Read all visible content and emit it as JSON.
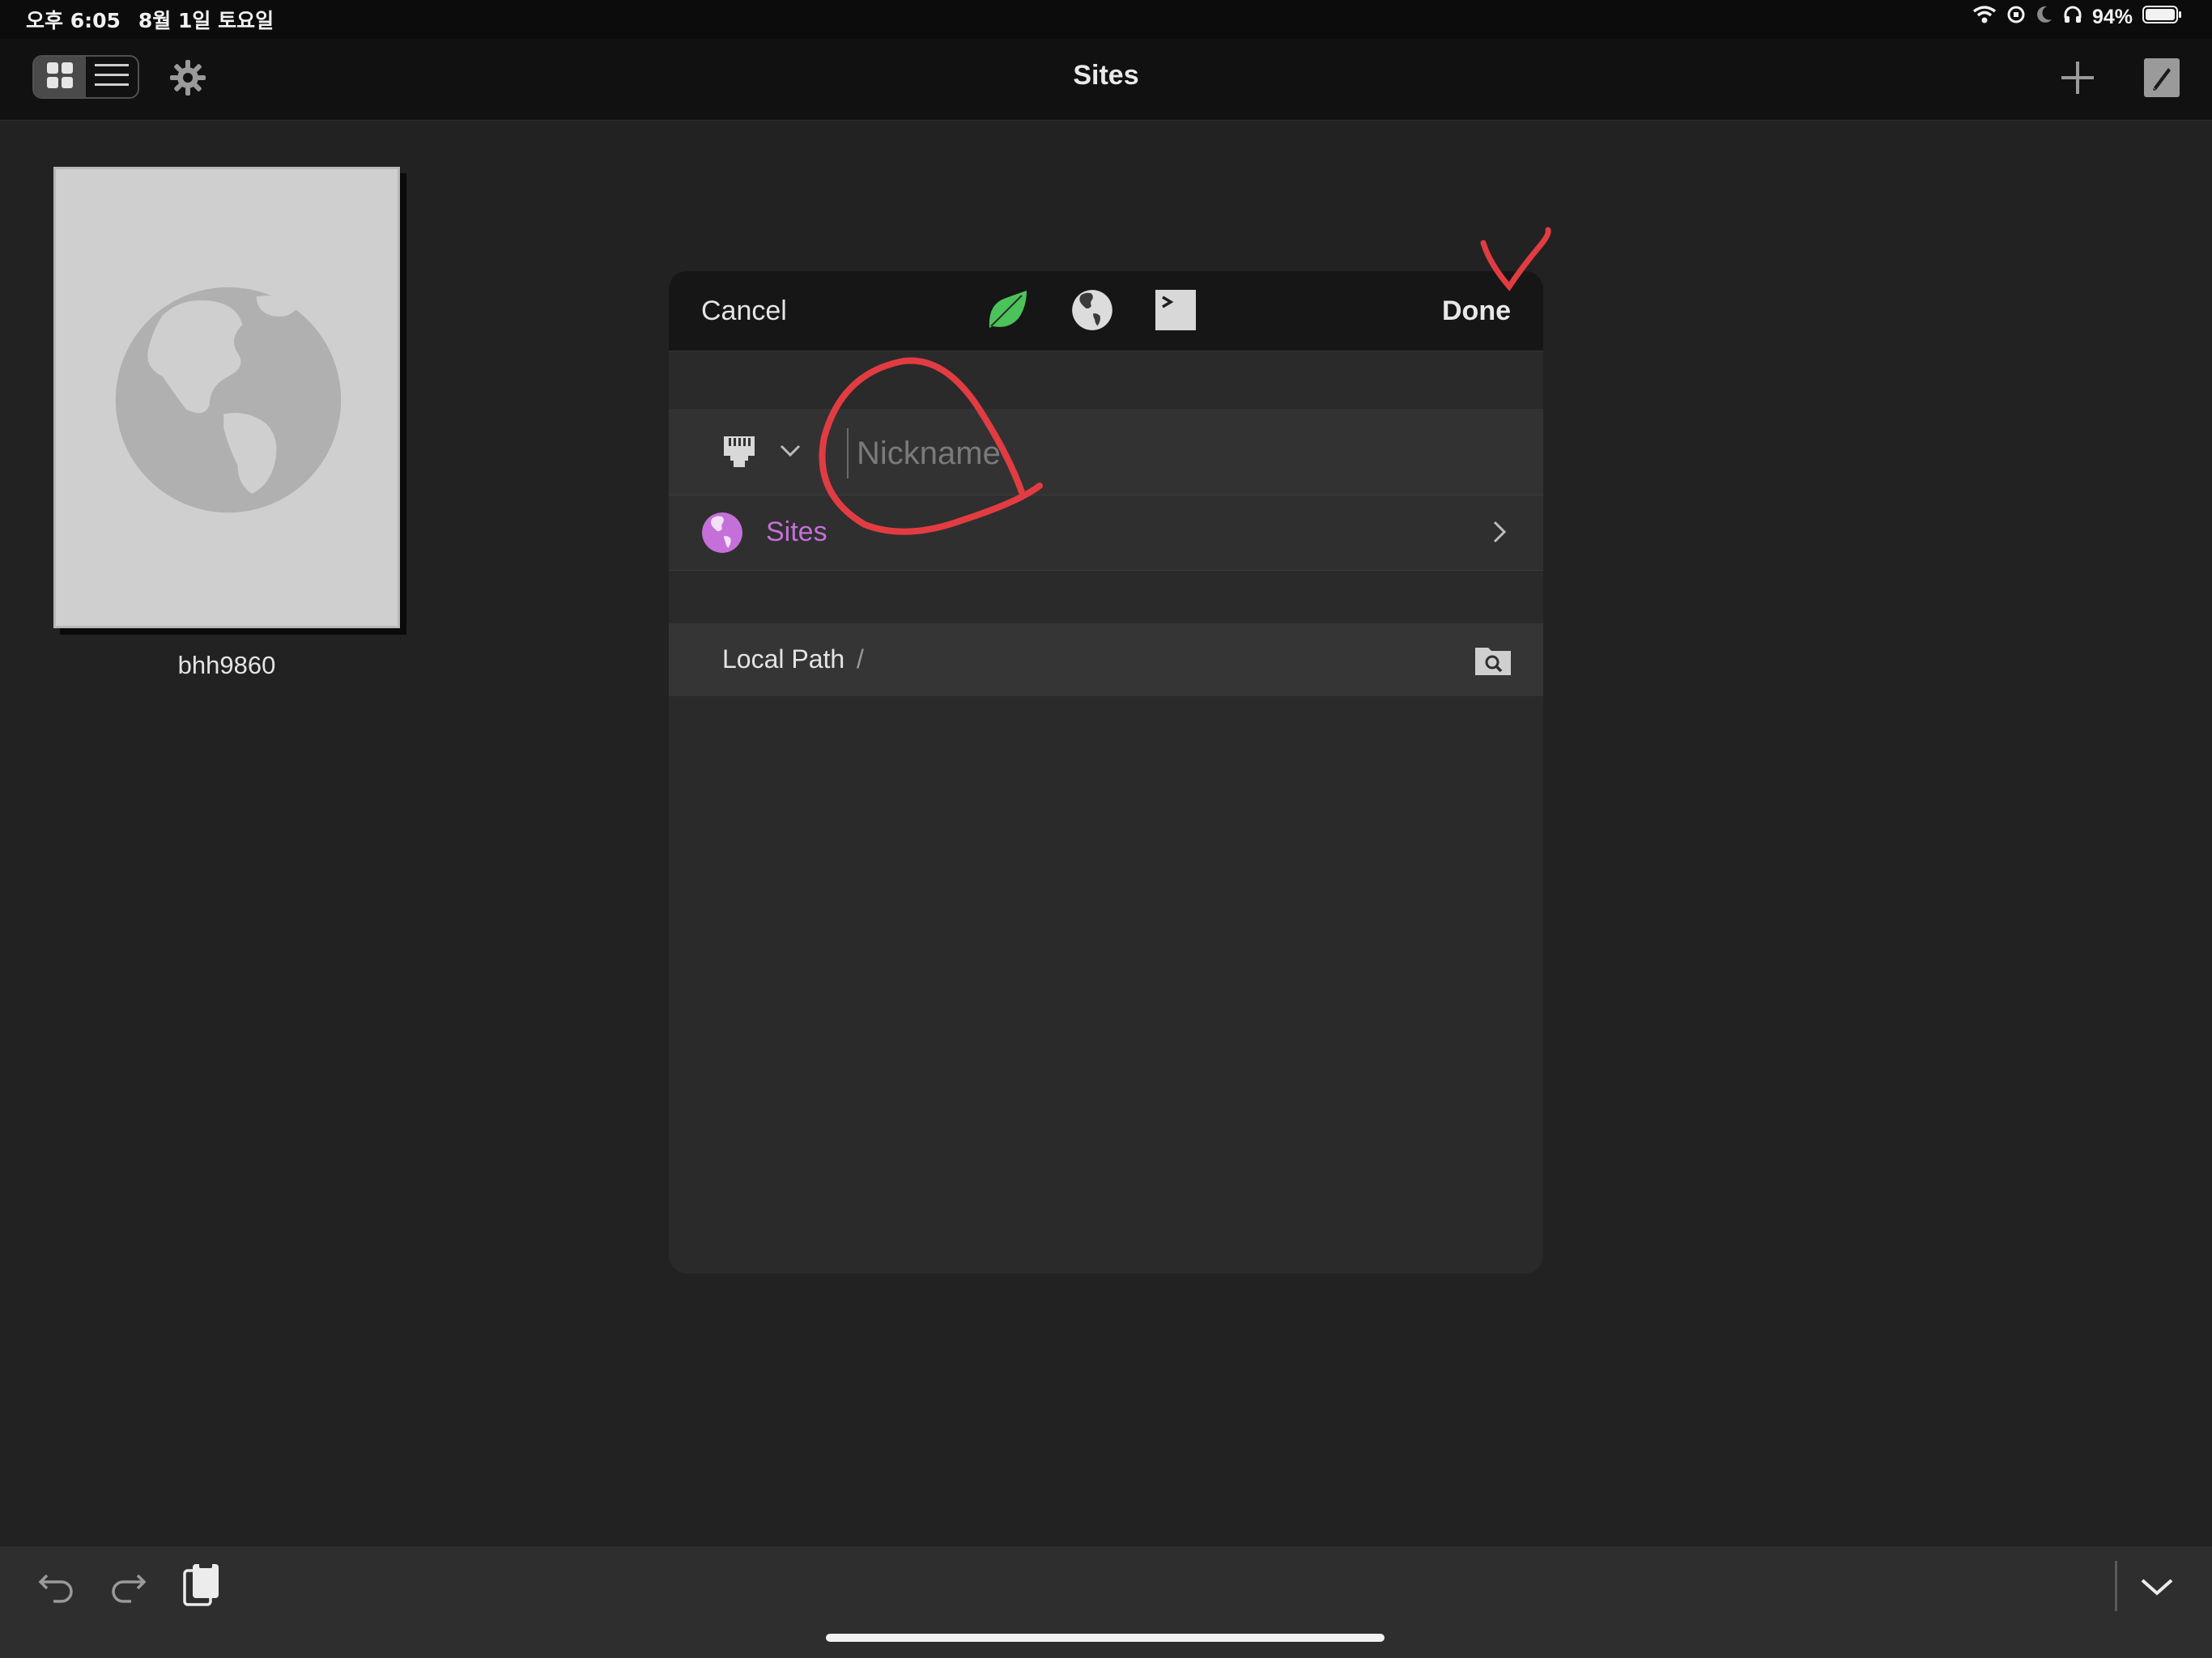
{
  "status_bar": {
    "time": "오후 6:05",
    "date": "8월 1일 토요일",
    "battery": "94%"
  },
  "nav": {
    "title": "Sites"
  },
  "tiles": [
    {
      "label": "bhh9860"
    }
  ],
  "dialog": {
    "cancel_label": "Cancel",
    "done_label": "Done",
    "nickname_placeholder": "Nickname",
    "sites_label": "Sites",
    "local_path_label": "Local Path",
    "local_path_value": "/"
  },
  "colors": {
    "accent_purple": "#c570d8",
    "leaf_green": "#4cc35a",
    "annotation_red": "#e23c42"
  }
}
